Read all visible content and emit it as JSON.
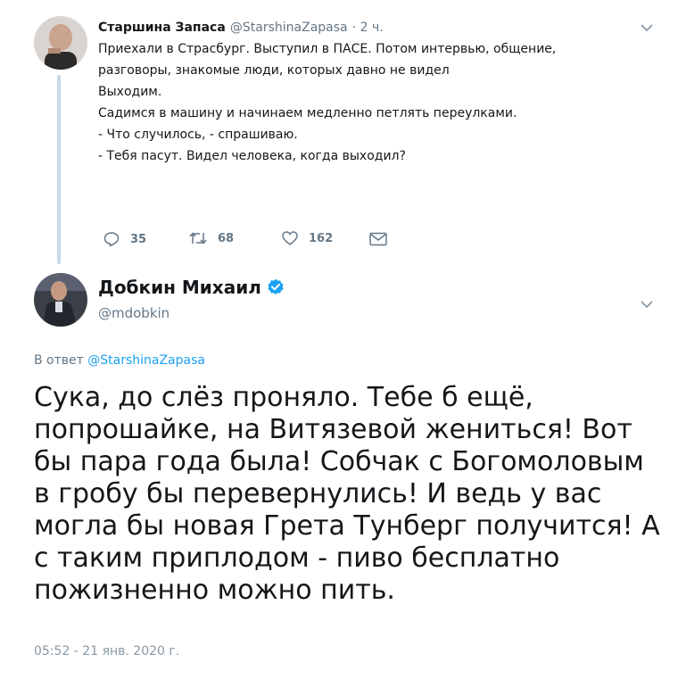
{
  "tweet1": {
    "name": "Старшина Запаса",
    "handle": "@StarshinaZapasa",
    "time": "· 2 ч.",
    "lines": [
      "Приехали в Страсбург. Выступил в ПАСЕ. Потом интервью, общение,",
      "разговоры, знакомые люди, которых давно не видел",
      "Выходим.",
      "Садимся в машину и начинаем медленно петлять переулками.",
      "- Что случилось, - спрашиваю.",
      "- Тебя пасут. Видел человека, когда выходил?"
    ],
    "actions": {
      "reply_icon": "reply-icon",
      "reply_count": "35",
      "retweet_icon": "retweet-icon",
      "retweet_count": "68",
      "like_icon": "heart-icon",
      "like_count": "162",
      "dm_icon": "envelope-icon"
    }
  },
  "tweet2": {
    "name": "Добкин Михаил",
    "handle": "@mdobkin",
    "verified_icon": "verified-badge-icon",
    "reply_prefix": "В ответ",
    "reply_mention": "@StarshinaZapasa",
    "lines": [
      "Сука, до слёз проняло. Тебе б ещё,",
      "попрошайке, на Витязевой жениться! Вот",
      "бы пара года была! Собчак с Богомоловым",
      "в гробу бы перевернулись! И ведь у вас",
      "могла бы новая Грета Тунберг получится! А",
      "с таким приплодом - пиво бесплатно",
      "пожизненно можно пить."
    ],
    "timestamp": "05:52 - 21 янв. 2020 г."
  },
  "colors": {
    "accent": "#1da1f2",
    "secondary_text": "#657786",
    "thread_line": "#c8d9e6"
  }
}
